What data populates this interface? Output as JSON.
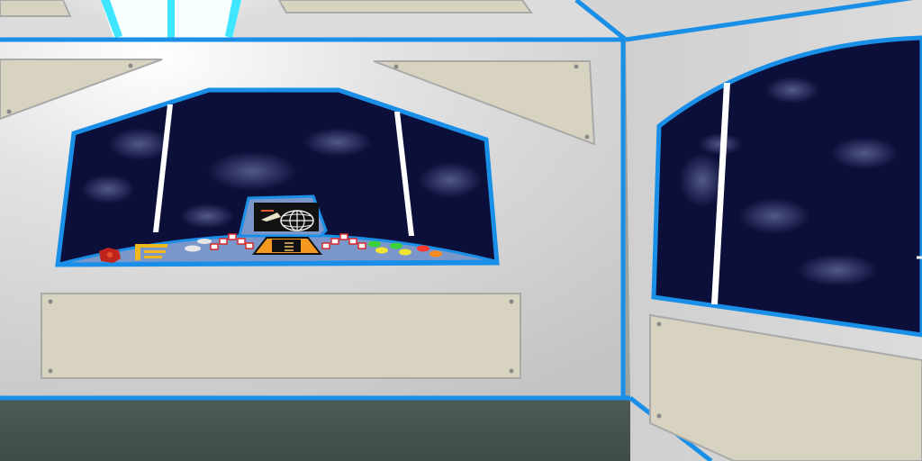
{
  "scene": {
    "type": "spaceship-interior",
    "description_visible_text": "",
    "colors": {
      "trim_blue": "#1a8fe8",
      "wall_light": "#d9d9d9",
      "wall_shadow": "#bdbdbd",
      "panel_beige": "#d8d3c0",
      "space_dark": "#0c0f3a",
      "floor": "#4a5a58",
      "console_blue": "#7b97c9",
      "light_cyan": "#3fe6ff",
      "star_haze": "#5a5f8f"
    },
    "console": {
      "indicator_lights": [
        "red",
        "red",
        "red",
        "red",
        "red",
        "red",
        "red",
        "red"
      ],
      "buttons": [
        {
          "color": "#3ad13a"
        },
        {
          "color": "#3ad13a"
        },
        {
          "color": "#f2e433"
        },
        {
          "color": "#f2e433"
        },
        {
          "color": "#ff3b2f"
        },
        {
          "color": "#ff8a1f"
        }
      ],
      "monitor_icon": "globe-grid-icon"
    }
  }
}
